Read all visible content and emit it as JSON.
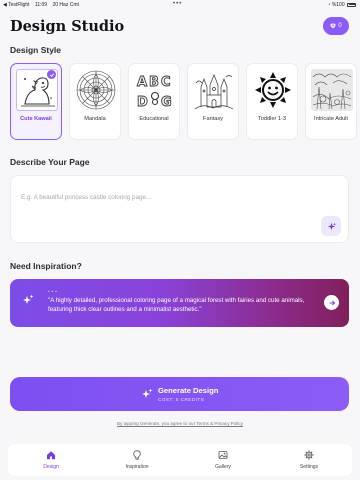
{
  "status_bar": {
    "back_app": "◀ TestFlight",
    "time": "11:09",
    "date": "20 Haz Cmt",
    "battery": "%100"
  },
  "header": {
    "title": "Design Studio",
    "credits": "0"
  },
  "design_style": {
    "heading": "Design Style",
    "items": [
      {
        "label": "Cute Kawaii",
        "selected": true
      },
      {
        "label": "Mandala",
        "selected": false
      },
      {
        "label": "Educational",
        "selected": false
      },
      {
        "label": "Fantasy",
        "selected": false
      },
      {
        "label": "Toddler 1-3",
        "selected": false
      },
      {
        "label": "Intricate Adult",
        "selected": false
      }
    ]
  },
  "describe": {
    "heading": "Describe Your Page",
    "placeholder": "E.g. A beautiful princess castle coloring page...",
    "value": ""
  },
  "inspiration": {
    "heading": "Need Inspiration?",
    "tag": "• • •",
    "text": "\"A highly detailed, professional coloring page of a magical forest with fairies and cute animals, featuring thick clear outlines and a minimalist aesthetic.\""
  },
  "generate": {
    "title": "Generate Design",
    "cost": "COST: 5 CREDITS"
  },
  "terms": "By tapping Generate, you agree to our Terms & Privacy Policy",
  "tabs": [
    {
      "label": "Design",
      "icon": "home-icon",
      "active": true
    },
    {
      "label": "Inspiration",
      "icon": "lightbulb-icon",
      "active": false
    },
    {
      "label": "Gallery",
      "icon": "gallery-icon",
      "active": false
    },
    {
      "label": "Settings",
      "icon": "gear-icon",
      "active": false
    }
  ],
  "colors": {
    "accent": "#8b5cf6",
    "inspiration_gradient_end": "#80205a"
  }
}
